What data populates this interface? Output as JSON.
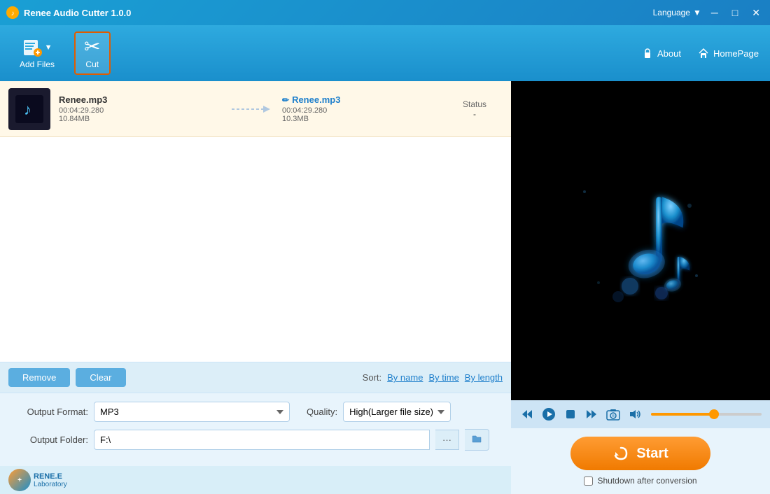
{
  "app": {
    "title": "Renee Audio Cutter 1.0.0",
    "language": "Language"
  },
  "toolbar": {
    "add_files_label": "Add Files",
    "cut_label": "Cut",
    "about_label": "About",
    "homepage_label": "HomePage"
  },
  "file_list": {
    "items": [
      {
        "name": "Renee.mp3",
        "duration": "00:04:29.280",
        "size": "10.84MB",
        "output_name": "Renee.mp3",
        "output_duration": "00:04:29.280",
        "output_size": "10.3MB",
        "status_label": "Status",
        "status_value": "-"
      }
    ]
  },
  "controls": {
    "remove_label": "Remove",
    "clear_label": "Clear",
    "sort_label": "Sort:",
    "sort_by_name": "By name",
    "sort_by_time": "By time",
    "sort_by_length": "By length"
  },
  "output": {
    "format_label": "Output Format:",
    "format_value": "MP3",
    "quality_label": "Quality:",
    "quality_value": "High(Larger file size)",
    "folder_label": "Output Folder:",
    "folder_value": "F:\\"
  },
  "player": {
    "volume_percent": 60
  },
  "start": {
    "label": "Start",
    "shutdown_label": "Shutdown after conversion"
  },
  "brand": {
    "name": "RENE.E",
    "subtitle": "Laboratory"
  },
  "icons": {
    "scissors": "✂",
    "music": "♪",
    "play": "▶",
    "pause": "⏸",
    "stop": "■",
    "prev": "⏮",
    "next": "⏭",
    "camera": "📷",
    "volume": "🔊",
    "refresh": "↻",
    "folder": "📁",
    "edit": "✏",
    "lock": "🔒",
    "home": "🏠"
  },
  "colors": {
    "toolbar_blue": "#1a8fcc",
    "accent_orange": "#ff9800",
    "bg_light": "#e8f4fc",
    "active_border": "#e05c00"
  }
}
